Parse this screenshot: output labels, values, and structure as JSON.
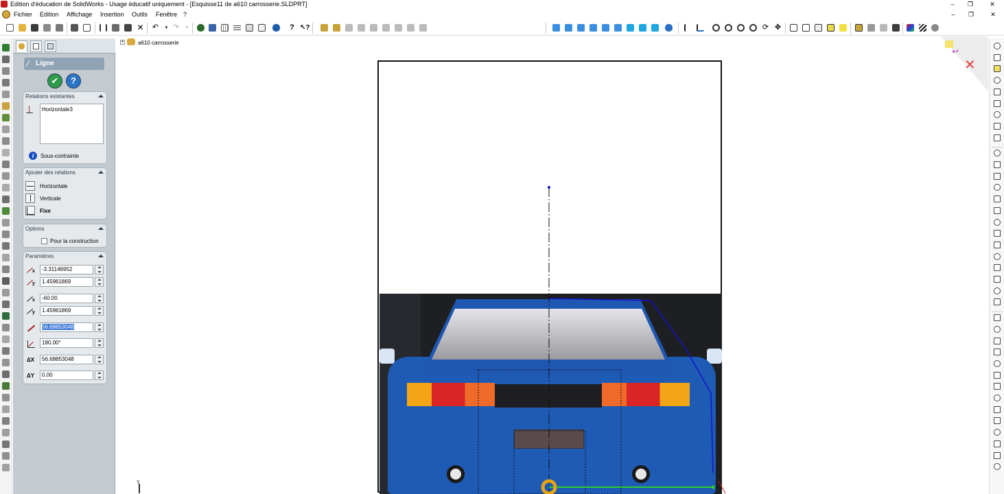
{
  "window": {
    "title": "Edition d'éducation de SolidWorks - Usage éducatif uniquement - [Esquisse11 de a610 carrosserie.SLDPRT]",
    "controls": [
      "‒",
      "❐",
      "✕"
    ]
  },
  "menu": {
    "items": [
      "Fichier",
      "Edition",
      "Affichage",
      "Insertion",
      "Outils",
      "Fenêtre",
      "?"
    ],
    "doc_controls": [
      "‒",
      "❐",
      "✕"
    ]
  },
  "feature_tree": {
    "root_label": "a610 carrosserie"
  },
  "property_manager": {
    "title": "Ligne",
    "ok_glyph": "✔",
    "help_glyph": "?",
    "relations_existantes": {
      "title": "Relations existantes",
      "items": [
        "Horizontale3"
      ],
      "status_glyph": "i",
      "status": "Sous-contrainte"
    },
    "ajouter_relations": {
      "title": "Ajouter des relations",
      "items": [
        {
          "label": "Horizontale",
          "icon": "horizontal-relation-icon"
        },
        {
          "label": "Verticale",
          "icon": "vertical-relation-icon"
        },
        {
          "label": "Fixe",
          "icon": "fix-relation-icon"
        }
      ]
    },
    "options": {
      "title": "Options",
      "construction_label": "Pour la construction",
      "construction_checked": false
    },
    "parametres": {
      "title": "Paramètres",
      "rows": [
        {
          "icon": "start-x-icon",
          "value": "-3.31146952",
          "selected": false
        },
        {
          "icon": "start-y-icon",
          "value": "1.45961869",
          "selected": false
        },
        {
          "icon": "end-x-icon",
          "value": "-60.00",
          "selected": false
        },
        {
          "icon": "end-y-icon",
          "value": "1.45961869",
          "selected": false
        },
        {
          "icon": "length-icon",
          "value": "56.68853048",
          "selected": true
        },
        {
          "icon": "angle-icon",
          "value": "180.00°",
          "selected": false
        },
        {
          "icon": "delta-x-icon",
          "value": "56.68853048",
          "selected": false,
          "prefix": "ΔX"
        },
        {
          "icon": "delta-y-icon",
          "value": "0.00",
          "selected": false,
          "prefix": "ΔY"
        }
      ]
    }
  },
  "viewport": {
    "axis_label": "Y",
    "colors": {
      "sketch_line": "#1414c8",
      "selected_line": "#2ecc2e",
      "endpoint_highlight": "#e8a317",
      "frame": "#111111"
    }
  }
}
